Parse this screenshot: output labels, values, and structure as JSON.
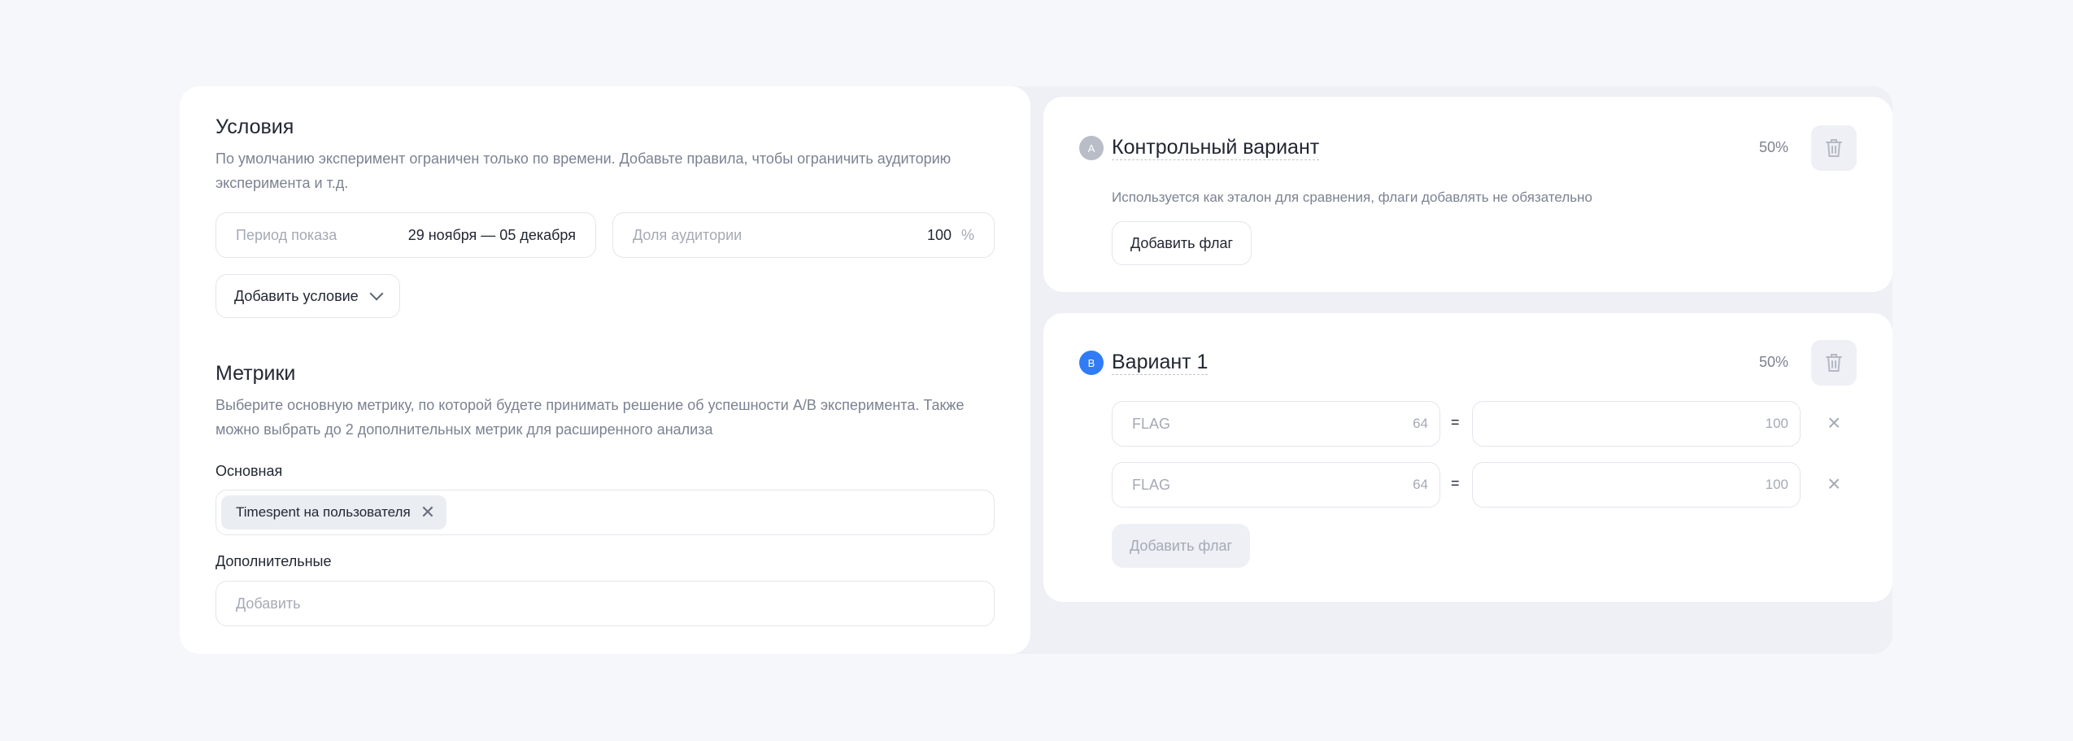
{
  "conditions": {
    "title": "Условия",
    "description": "По умолчанию эксперимент ограничен только по времени. Добавьте правила, чтобы ограничить аудиторию эксперимента и т.д.",
    "period_label": "Период показа",
    "period_value": "29 ноября — 05 декабря",
    "audience_label": "Доля аудитории",
    "audience_value": "100",
    "audience_unit": "%",
    "add_condition_label": "Добавить условие"
  },
  "metrics": {
    "title": "Метрики",
    "description": "Выберите основную метрику, по которой будете принимать решение об успешности A/B эксперимента. Также можно выбрать до 2 дополнительных метрик для расширенного анализа",
    "primary_label": "Основная",
    "primary_chip": "Timespent на пользователя",
    "additional_label": "Дополнительные",
    "additional_placeholder": "Добавить"
  },
  "variants": [
    {
      "badge": "A",
      "badge_color": "#b8bdc7",
      "title": "Контрольный вариант",
      "percent": "50%",
      "description": "Используется как эталон для сравнения, флаги добавлять не обязательно",
      "add_flag_label": "Добавить флаг"
    },
    {
      "badge": "B",
      "badge_color": "#2f7cf6",
      "title": "Вариант 1",
      "percent": "50%",
      "flags": [
        {
          "name_placeholder": "FLAG",
          "name_limit": "64",
          "equals": "=",
          "value_limit": "100"
        },
        {
          "name_placeholder": "FLAG",
          "name_limit": "64",
          "equals": "=",
          "value_limit": "100"
        }
      ],
      "add_flag_label": "Добавить флаг"
    }
  ]
}
